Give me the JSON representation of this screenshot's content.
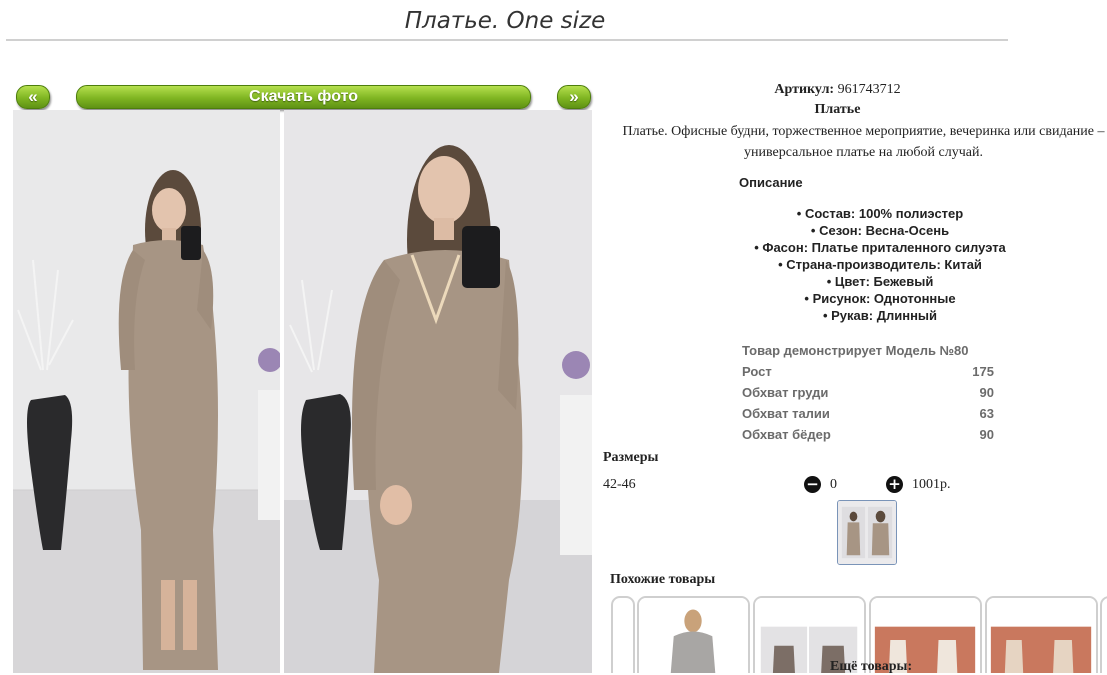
{
  "page": {
    "title": "Платье. One size"
  },
  "gallery": {
    "prev_label": "«",
    "download_label": "Скачать фото",
    "next_label": "»"
  },
  "product": {
    "article_label": "Артикул:",
    "article_value": "961743712",
    "name": "Платье",
    "description": "Платье. Офисные будни, торжественное мероприятие, вечеринка или свидание – универсальное платье на любой случай.",
    "details_heading": "Описание",
    "features": [
      "Состав: 100% полиэстер",
      "Сезон: Весна-Осень",
      "Фасон: Платье приталенного силуэта",
      "Страна-производитель: Китай",
      "Цвет: Бежевый",
      "Рисунок: Однотонные",
      "Рукав: Длинный"
    ]
  },
  "model": {
    "heading": "Товар демонстрирует Модель №80",
    "rows": [
      {
        "label": "Рост",
        "value": "175"
      },
      {
        "label": "Обхват груди",
        "value": "90"
      },
      {
        "label": "Обхват талии",
        "value": "63"
      },
      {
        "label": "Обхват бёдер",
        "value": "90"
      }
    ]
  },
  "sizes": {
    "heading": "Размеры",
    "size": "42-46",
    "minus_icon": "minus-circle-icon",
    "quantity": "0",
    "plus_icon": "plus-circle-icon",
    "price": "1001р."
  },
  "similar": {
    "heading": "Похожие товары",
    "more_label": "Ещё товары:"
  },
  "colors": {
    "button_green": "#7fb522",
    "dress_beige": "#a79584"
  }
}
